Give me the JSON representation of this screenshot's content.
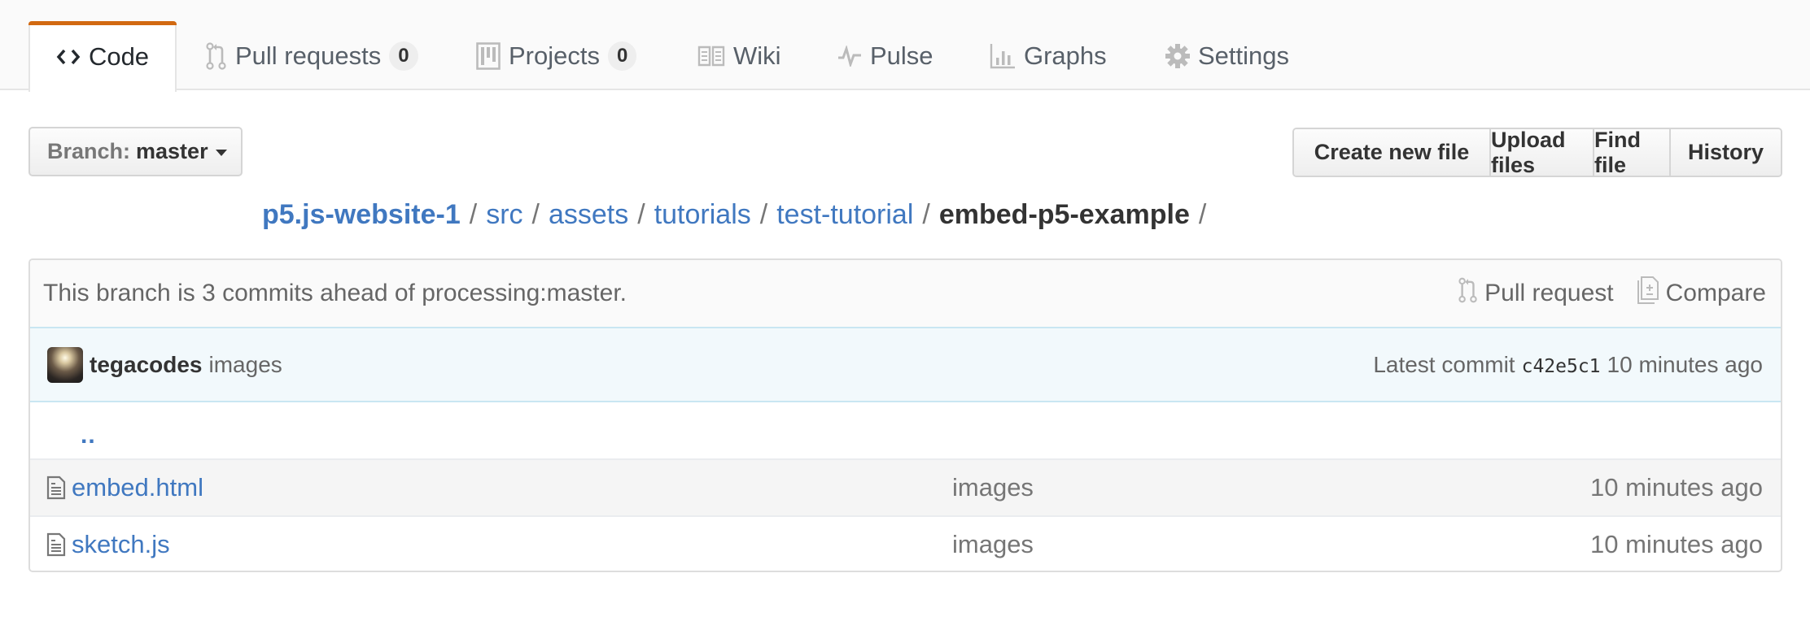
{
  "tabs": [
    {
      "label": "Code",
      "icon": "code-icon",
      "selected": true
    },
    {
      "label": "Pull requests",
      "icon": "git-pull-request-icon",
      "count": "0"
    },
    {
      "label": "Projects",
      "icon": "project-icon",
      "count": "0"
    },
    {
      "label": "Wiki",
      "icon": "book-icon"
    },
    {
      "label": "Pulse",
      "icon": "pulse-icon"
    },
    {
      "label": "Graphs",
      "icon": "graph-icon"
    },
    {
      "label": "Settings",
      "icon": "gear-icon"
    }
  ],
  "branch": {
    "label": "Branch:",
    "value": "master"
  },
  "file_actions": {
    "create": "Create new file",
    "upload": "Upload files",
    "find": "Find file",
    "history": "History"
  },
  "breadcrumb": {
    "root": "p5.js-website-1",
    "segments": [
      "src",
      "assets",
      "tutorials",
      "test-tutorial"
    ],
    "current": "embed-p5-example",
    "separator": "/"
  },
  "branch_status": {
    "message": "This branch is 3 commits ahead of processing:master.",
    "pull_request": "Pull request",
    "compare": "Compare"
  },
  "latest_commit": {
    "author": "tegacodes",
    "message": "images",
    "label": "Latest commit",
    "sha": "c42e5c1",
    "age": "10 minutes ago"
  },
  "files": {
    "up_link": "..",
    "items": [
      {
        "name": "embed.html",
        "message": "images",
        "age": "10 minutes ago"
      },
      {
        "name": "sketch.js",
        "message": "images",
        "age": "10 minutes ago"
      }
    ]
  },
  "colors": {
    "accent_tab": "#d26911",
    "link": "#4078c0",
    "commit_bg": "#f2f9fc"
  }
}
